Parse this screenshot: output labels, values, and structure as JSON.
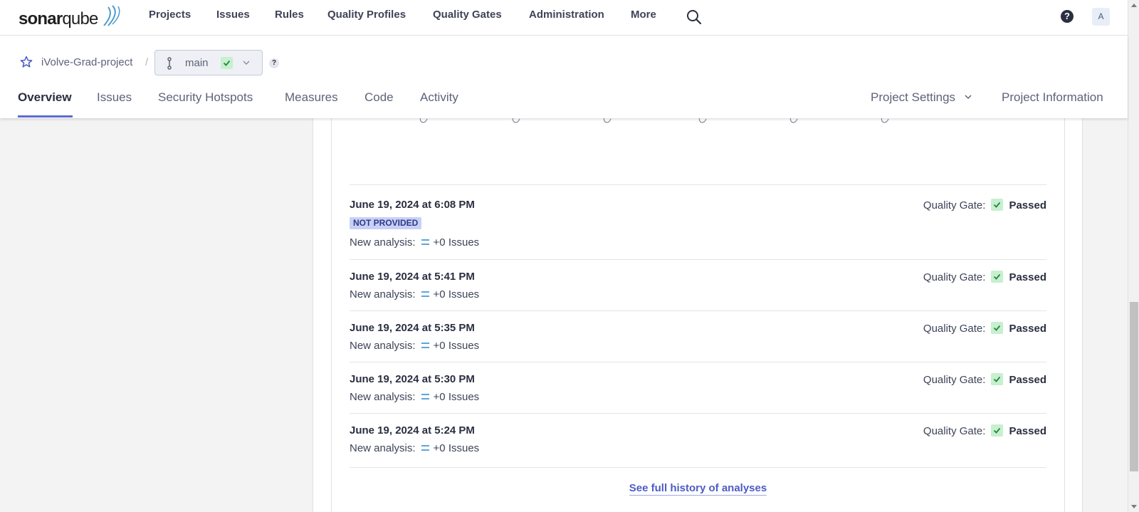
{
  "global_nav": {
    "logo_text_bold": "sonar",
    "logo_text_light": "qube",
    "items": [
      "Projects",
      "Issues",
      "Rules",
      "Quality Profiles",
      "Quality Gates",
      "Administration",
      "More"
    ],
    "help": "?",
    "avatar": "A"
  },
  "project": {
    "name": "iVolve-Grad-project",
    "separator": "/",
    "branch": "main",
    "branch_help": "?"
  },
  "tabs": [
    "Overview",
    "Issues",
    "Security Hotspots",
    "Measures",
    "Code",
    "Activity"
  ],
  "active_tab": "Overview",
  "right_tabs": {
    "settings": "Project Settings",
    "information": "Project Information"
  },
  "analyses": [
    {
      "date": "June 19, 2024 at 6:08 PM",
      "version": "NOT PROVIDED",
      "label": "New analysis:",
      "issues": "+0 Issues",
      "qg_label": "Quality Gate:",
      "qg_status": "Passed"
    },
    {
      "date": "June 19, 2024 at 5:41 PM",
      "label": "New analysis:",
      "issues": "+0 Issues",
      "qg_label": "Quality Gate:",
      "qg_status": "Passed"
    },
    {
      "date": "June 19, 2024 at 5:35 PM",
      "label": "New analysis:",
      "issues": "+0 Issues",
      "qg_label": "Quality Gate:",
      "qg_status": "Passed"
    },
    {
      "date": "June 19, 2024 at 5:30 PM",
      "label": "New analysis:",
      "issues": "+0 Issues",
      "qg_label": "Quality Gate:",
      "qg_status": "Passed"
    },
    {
      "date": "June 19, 2024 at 5:24 PM",
      "label": "New analysis:",
      "issues": "+0 Issues",
      "qg_label": "Quality Gate:",
      "qg_status": "Passed"
    }
  ],
  "history_link": "See full history of analyses",
  "colors": {
    "accent": "#5d6cd4",
    "passed_bg": "#c8efd0",
    "passed_check": "#1f8a3b",
    "version_badge_bg": "#c9d0f5"
  },
  "icons": [
    "search-icon",
    "help-icon",
    "star-icon",
    "branch-icon",
    "check-icon",
    "chevron-down-icon",
    "equals-icon"
  ]
}
